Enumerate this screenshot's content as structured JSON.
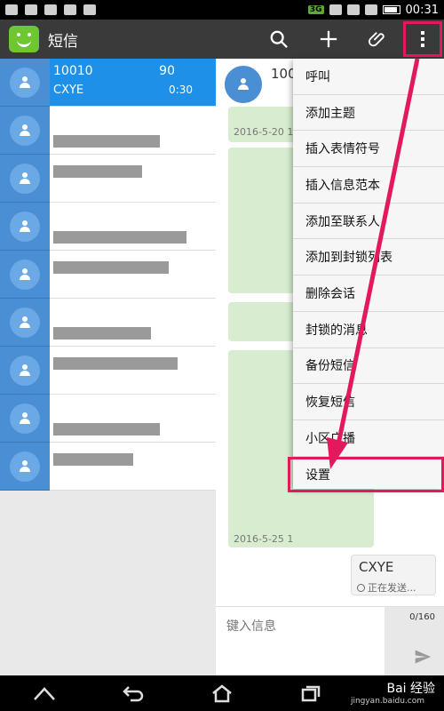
{
  "statusbar": {
    "time": "00:31",
    "network": "3G"
  },
  "actionbar": {
    "title": "短信",
    "icons": [
      "search-icon",
      "add-icon",
      "attach-icon",
      "overflow-icon"
    ]
  },
  "conversation_list": {
    "selected": {
      "name": "10010",
      "count": "90",
      "sender": "CXYE",
      "time": "0:30"
    }
  },
  "chat": {
    "title": "100",
    "dates": [
      "2016-5-20 11",
      "2016-5-25 1"
    ],
    "outgoing": {
      "text": "CXYE",
      "status": "正在发送..."
    },
    "composer": {
      "placeholder": "键入信息",
      "char_count": "0/160"
    }
  },
  "menu": {
    "items": [
      "呼叫",
      "添加主题",
      "插入表情符号",
      "插入信息范本",
      "添加至联系人",
      "添加到封锁列表",
      "删除会话",
      "封锁的消息",
      "备份短信",
      "恢复短信",
      "小区广播",
      "设置"
    ]
  },
  "colors": {
    "accent": "#1e90e8",
    "annotation": "#e2195d",
    "actionbar": "#3a3a3a",
    "app_icon": "#6ec630"
  },
  "watermark": {
    "text": "Bai 经验",
    "sub": "jingyan.baidu.com"
  }
}
